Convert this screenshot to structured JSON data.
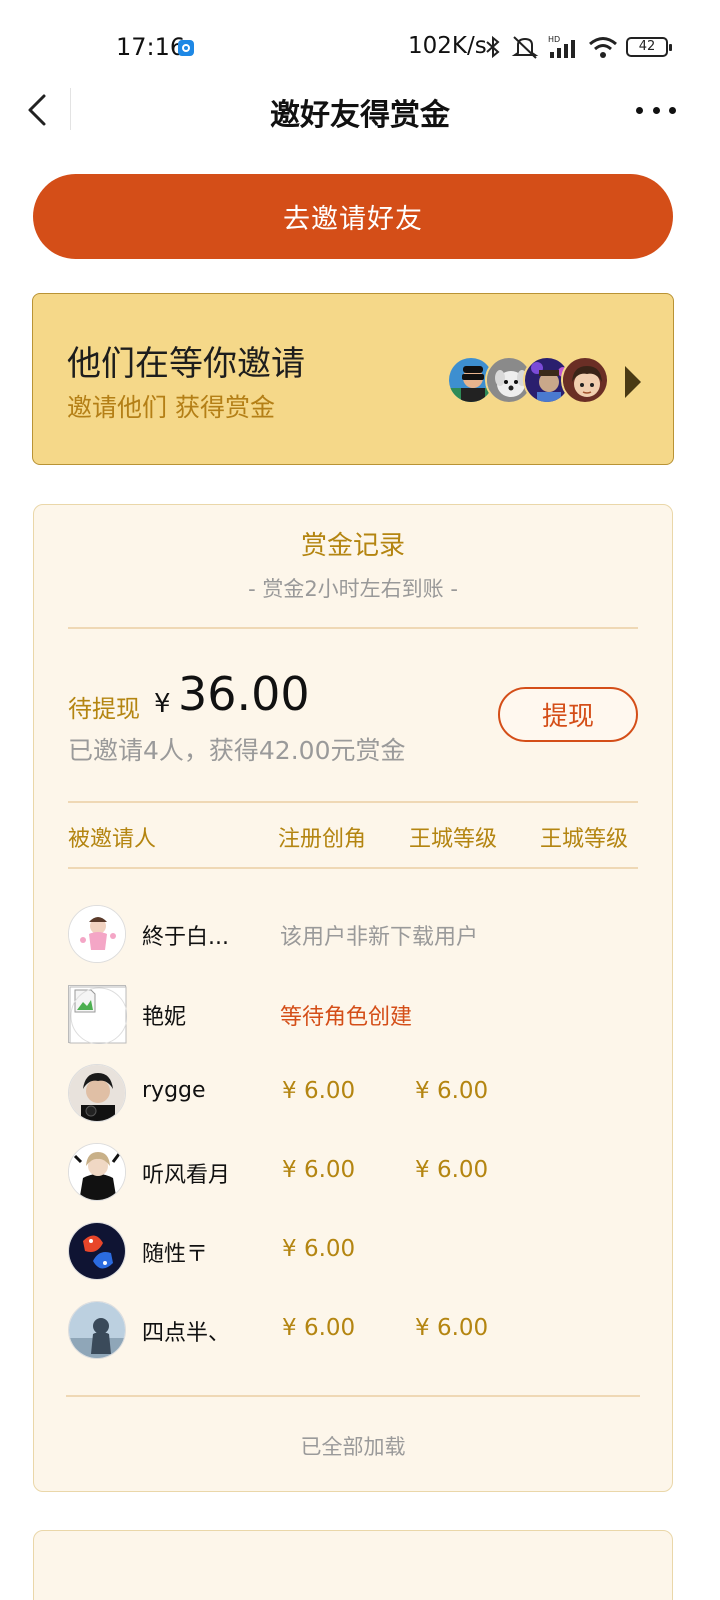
{
  "status_bar": {
    "time": "17:16",
    "network_speed": "102K/s",
    "battery": "42",
    "icons": [
      "app-notification-icon",
      "bluetooth-icon",
      "mute-icon",
      "hd-signal-icon",
      "wifi-icon",
      "battery-icon"
    ]
  },
  "nav": {
    "title": "邀好友得赏金"
  },
  "invite_button_label": "去邀请好友",
  "waiting": {
    "title": "他们在等你邀请",
    "subtitle": "邀请他们 获得赏金",
    "avatar_count": 4
  },
  "records": {
    "title": "赏金记录",
    "note": "- 赏金2小时左右到账 -",
    "pending_label": "待提现",
    "currency": "¥",
    "pending_amount": "36.00",
    "invited_summary": "已邀请4人，获得42.00元赏金",
    "withdraw_label": "提现",
    "columns": [
      "被邀请人",
      "注册创角",
      "王城等级",
      "王城等级"
    ],
    "rows": [
      {
        "name": "終于白...",
        "status": "该用户非新下载用户",
        "reward_1": "",
        "reward_2": ""
      },
      {
        "name": "艳妮",
        "status": "等待角色创建",
        "reward_1": "",
        "reward_2": ""
      },
      {
        "name": "rygge",
        "status": "",
        "reward_1": "¥ 6.00",
        "reward_2": "¥ 6.00"
      },
      {
        "name": "听风看月",
        "status": "",
        "reward_1": "¥ 6.00",
        "reward_2": "¥ 6.00"
      },
      {
        "name": "随性〒",
        "status": "",
        "reward_1": "¥ 6.00",
        "reward_2": ""
      },
      {
        "name": "四点半、",
        "status": "",
        "reward_1": "¥ 6.00",
        "reward_2": "¥ 6.00"
      }
    ],
    "footer": "已全部加载"
  },
  "colors": {
    "accent_orange": "#d44e18",
    "gold_text": "#b48511",
    "waiting_bg": "#f5d889",
    "card_bg": "#fdf6ea"
  }
}
